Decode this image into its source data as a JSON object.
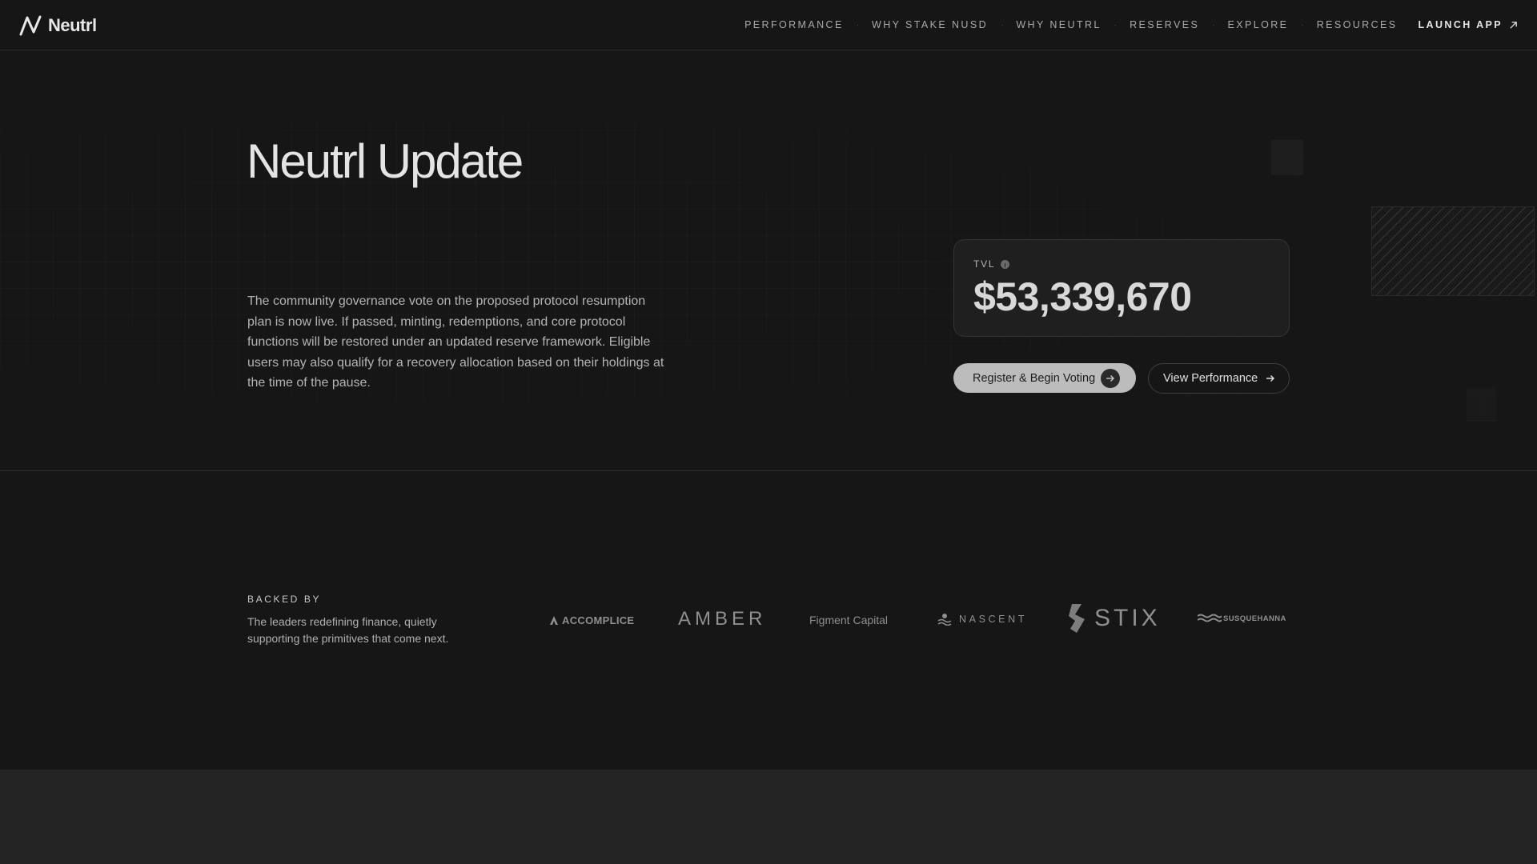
{
  "brand": {
    "name": "Neutrl"
  },
  "nav": {
    "items": [
      "PERFORMANCE",
      "WHY STAKE NUSD",
      "WHY NEUTRL",
      "RESERVES",
      "EXPLORE",
      "RESOURCES"
    ],
    "separator": "·",
    "launch_label": "LAUNCH APP"
  },
  "hero": {
    "title": "Neutrl Update",
    "description": "The community governance vote on the proposed protocol resumption plan is now live. If passed, minting, redemptions, and core protocol functions will be restored under an updated reserve framework. Eligible users may also qualify for a recovery allocation based on their holdings at the time of the pause.",
    "tvl_label": "TVL",
    "tvl_value": "$53,339,670",
    "primary_button": "Register & Begin Voting",
    "secondary_button": "View Performance"
  },
  "backed": {
    "label": "BACKED BY",
    "description": "The leaders redefining finance, quietly supporting the primitives that come next.",
    "partners": {
      "accomplice": "ACCOMPLICE",
      "amber": "AMBER",
      "figment": "Figment Capital",
      "nascent": "NASCENT",
      "stix": "STIX",
      "susquehanna": "SUSQUEHANNA"
    }
  },
  "colors": {
    "background": "#161616",
    "accent_button": "#bcbcbc",
    "bottom_band": "#242424"
  }
}
